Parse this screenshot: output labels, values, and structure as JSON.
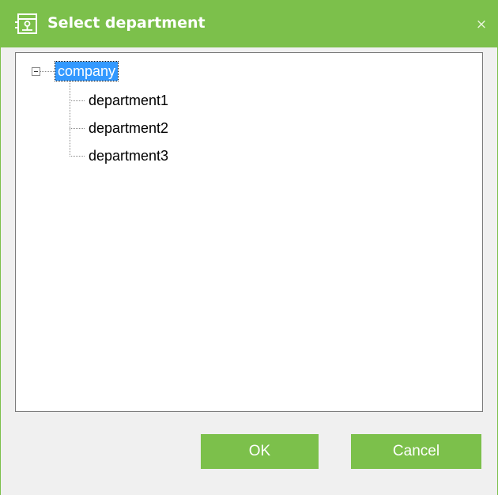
{
  "dialog": {
    "title": "Select department",
    "close_glyph": "×"
  },
  "tree": {
    "root": {
      "label": "company",
      "expander_icon": "minus-box-icon",
      "selected": true
    },
    "children": [
      {
        "label": "department1"
      },
      {
        "label": "department2"
      },
      {
        "label": "department3"
      }
    ]
  },
  "buttons": {
    "ok_label": "OK",
    "cancel_label": "Cancel"
  },
  "colors": {
    "accent": "#7cc04b",
    "selection": "#3399ff",
    "panel_border": "#7a7a7a"
  }
}
